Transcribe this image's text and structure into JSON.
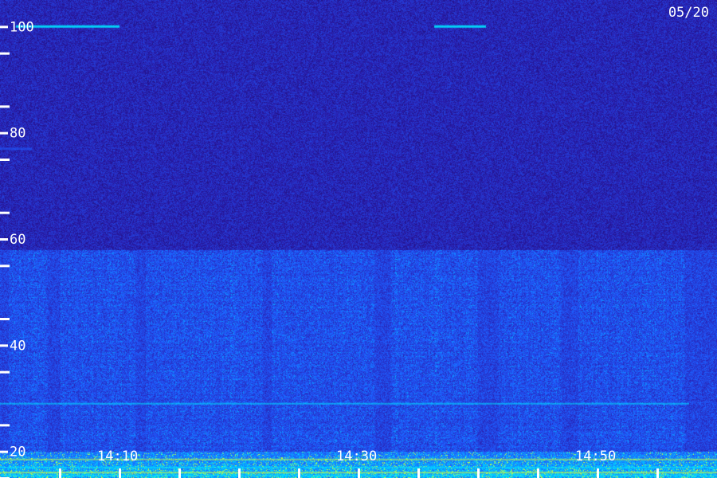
{
  "chart_data": {
    "type": "heatmap",
    "date_label": "05/20",
    "y_axis": {
      "range": [
        15,
        105
      ],
      "labeled_ticks": [
        {
          "value": 100,
          "label": "100"
        },
        {
          "value": 80,
          "label": "80"
        },
        {
          "value": 60,
          "label": "60"
        },
        {
          "value": 40,
          "label": "40"
        },
        {
          "value": 20,
          "label": "20"
        }
      ],
      "minor_ticks": [
        15,
        25,
        35,
        45,
        55,
        65,
        75,
        85,
        95
      ]
    },
    "x_axis": {
      "labeled_ticks": [
        {
          "value": "14:10",
          "label": "14:10"
        },
        {
          "value": "14:30",
          "label": "14:30"
        },
        {
          "value": "14:50",
          "label": "14:50"
        }
      ],
      "minor_tick_interval_minutes": 5
    },
    "colors": {
      "background": "#1a0f5e",
      "low": "#2a1aa8",
      "mid": "#1f5cff",
      "high": "#00e5ff",
      "peak": "#c8ff3c",
      "tick": "#ffffff"
    }
  }
}
